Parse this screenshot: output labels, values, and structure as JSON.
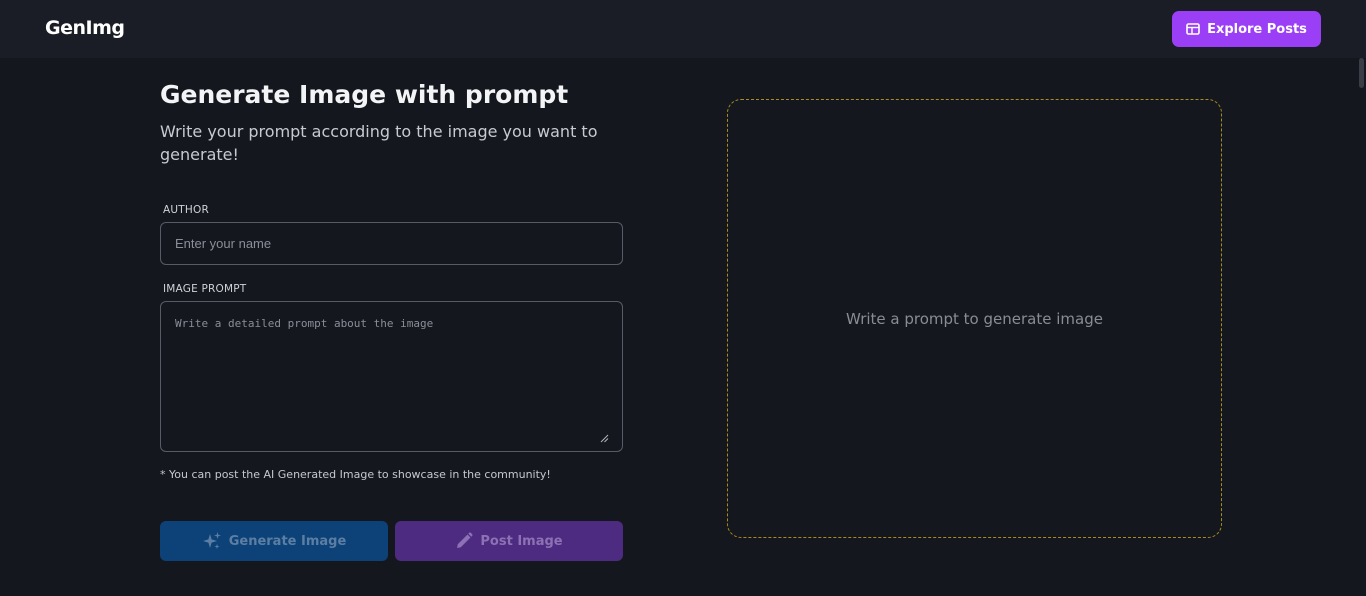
{
  "navbar": {
    "logo": "GenImg",
    "explore_label": "Explore Posts",
    "explore_icon": "cards-icon"
  },
  "form": {
    "title": "Generate Image with prompt",
    "subtitle": "Write your prompt according to the image you want to generate!",
    "author_label": "AUTHOR",
    "author_placeholder": "Enter your name",
    "author_value": "",
    "prompt_label": "IMAGE PROMPT",
    "prompt_placeholder": "Write a detailed prompt about the image",
    "prompt_value": "",
    "helper": "* You can post the AI Generated Image to showcase in the community!",
    "generate_label": "Generate Image",
    "generate_icon": "sparkles-icon",
    "post_label": "Post Image",
    "post_icon": "pencil-icon"
  },
  "preview": {
    "placeholder": "Write a prompt to generate image"
  },
  "colors": {
    "accent": "#9b3ff6",
    "generate_bg": "#0c4277",
    "post_bg": "#4d2b80",
    "preview_border": "#a88c20",
    "background": "#15171e"
  }
}
